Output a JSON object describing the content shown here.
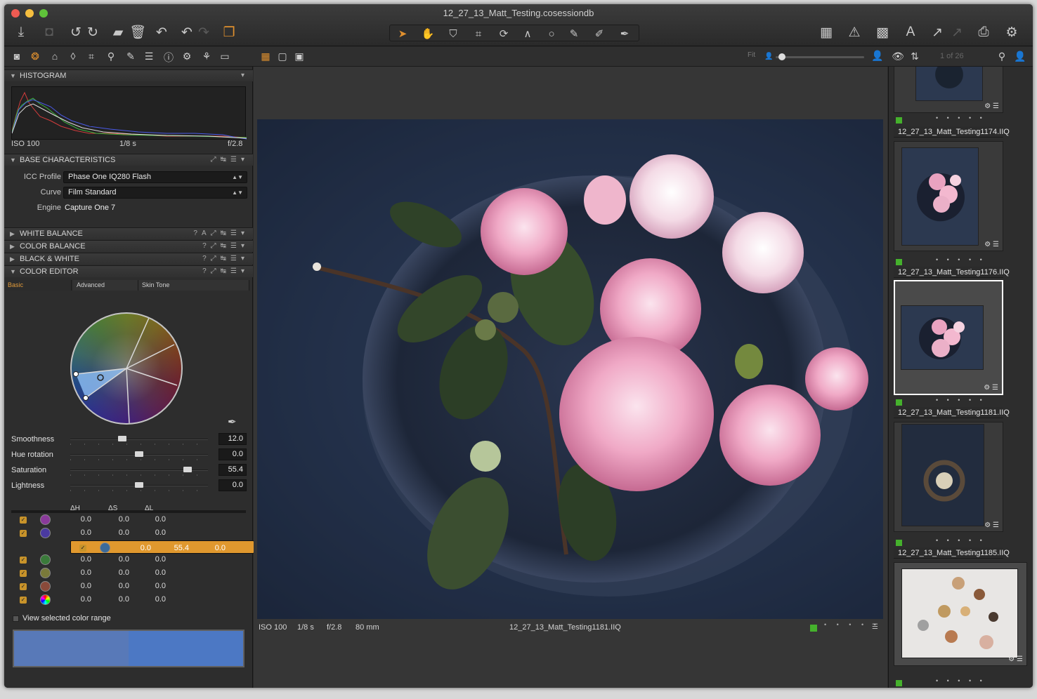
{
  "window": {
    "title": "12_27_13_Matt_Testing.cosessiondb"
  },
  "toolbar": {
    "icons": [
      "import-icon",
      "camera-icon",
      "rotate-left-icon",
      "rotate-right-icon",
      "open-folder-icon",
      "trash-icon",
      "undo-icon",
      "undo-small-icon",
      "redo-icon",
      "variants-icon"
    ],
    "cursor_tools": [
      "select-icon",
      "pan-icon",
      "loupe-icon",
      "crop-icon",
      "rotate-icon",
      "keystone-icon",
      "circle-spot-icon",
      "brush-icon",
      "eraser-icon",
      "picker-icon"
    ],
    "right_icons": [
      "grid-icon",
      "warning-icon",
      "overlay-icon",
      "text-icon",
      "arrow-icon",
      "arrow-dim-icon",
      "print-icon",
      "settings-icon"
    ]
  },
  "toolstrip": {
    "fit_label": "Fit",
    "counter": "1 of 26"
  },
  "histogram": {
    "title": "HISTOGRAM",
    "iso": "ISO 100",
    "shutter": "1/8 s",
    "aperture": "f/2.8"
  },
  "base": {
    "title": "BASE CHARACTERISTICS",
    "icc_label": "ICC Profile",
    "icc_value": "Phase One IQ280 Flash",
    "curve_label": "Curve",
    "curve_value": "Film Standard",
    "engine_label": "Engine",
    "engine_value": "Capture One 7"
  },
  "panels": [
    "WHITE BALANCE",
    "COLOR BALANCE",
    "BLACK & WHITE",
    "COLOR EDITOR"
  ],
  "color_editor": {
    "tabs": [
      "Basic",
      "Advanced",
      "Skin Tone"
    ],
    "sliders": [
      {
        "name": "Smoothness",
        "value": "12.0",
        "pos": 0.38
      },
      {
        "name": "Hue rotation",
        "value": "0.0",
        "pos": 0.5
      },
      {
        "name": "Saturation",
        "value": "55.4",
        "pos": 0.85
      },
      {
        "name": "Lightness",
        "value": "0.0",
        "pos": 0.5
      }
    ],
    "headers": [
      "ΔH",
      "ΔS",
      "ΔL"
    ],
    "rows": [
      {
        "color": "#8a3a9a",
        "h": "0.0",
        "s": "0.0",
        "l": "0.0"
      },
      {
        "color": "#4a3aa0",
        "h": "0.0",
        "s": "0.0",
        "l": "0.0"
      },
      {
        "color": "#3a6a9a",
        "h": "0.0",
        "s": "55.4",
        "l": "0.0",
        "selected": true
      },
      {
        "color": "#3a7a3a",
        "h": "0.0",
        "s": "0.0",
        "l": "0.0"
      },
      {
        "color": "#7a7a3a",
        "h": "0.0",
        "s": "0.0",
        "l": "0.0"
      },
      {
        "color": "#8a4a3a",
        "h": "0.0",
        "s": "0.0",
        "l": "0.0"
      },
      {
        "color": "rainbow",
        "h": "0.0",
        "s": "0.0",
        "l": "0.0"
      }
    ],
    "view_range": "View selected color range"
  },
  "viewer": {
    "iso": "ISO 100",
    "shutter": "1/8 s",
    "aperture": "f/2.8",
    "focal": "80 mm",
    "filename": "12_27_13_Matt_Testing1181.IIQ"
  },
  "browser": {
    "items": [
      {
        "name": "12_27_13_Matt_Testing1174.IIQ"
      },
      {
        "name": "12_27_13_Matt_Testing1176.IIQ"
      },
      {
        "name": "12_27_13_Matt_Testing1181.IIQ",
        "selected": true
      },
      {
        "name": "12_27_13_Matt_Testing1185.IIQ"
      }
    ]
  }
}
